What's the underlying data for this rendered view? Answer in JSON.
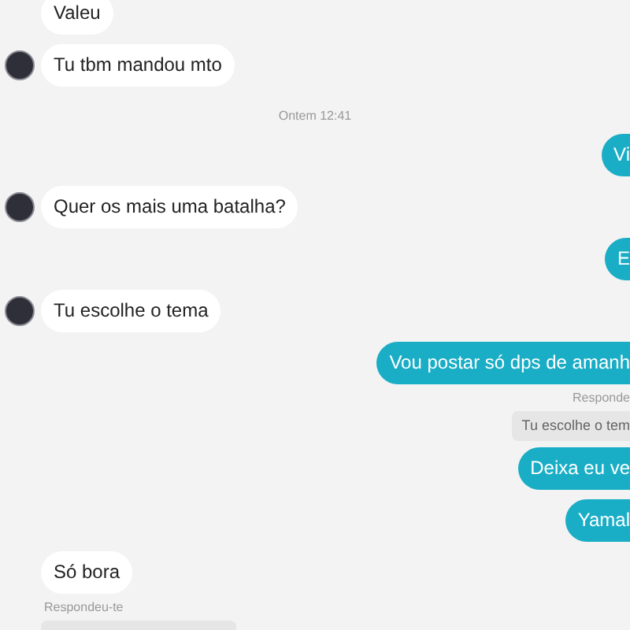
{
  "messages": [
    {
      "kind": "incoming",
      "text": "Valeu",
      "avatar": false
    },
    {
      "kind": "incoming",
      "text": "Tu tbm mandou mto",
      "avatar": true
    },
    {
      "kind": "timestamp",
      "text": "Ontem 12:41"
    },
    {
      "kind": "outgoing",
      "text": "Vi"
    },
    {
      "kind": "incoming",
      "text": "Quer os mais uma batalha?",
      "avatar": true
    },
    {
      "kind": "outgoing",
      "text": "E"
    },
    {
      "kind": "incoming",
      "text": "Tu escolhe o tema",
      "avatar": true
    },
    {
      "kind": "outgoing",
      "text": "Vou postar só dps de amanh"
    },
    {
      "kind": "sent_reply_label",
      "text": "Responde"
    },
    {
      "kind": "sent_reply_quote",
      "text": "Tu escolhe o tem"
    },
    {
      "kind": "outgoing",
      "text": "Deixa eu ve"
    },
    {
      "kind": "outgoing",
      "text": "Yamal"
    },
    {
      "kind": "incoming",
      "text": "Só bora",
      "avatar": false
    },
    {
      "kind": "received_reply_label",
      "text": "Respondeu-te"
    },
    {
      "kind": "received_reply_quote_cut"
    }
  ]
}
